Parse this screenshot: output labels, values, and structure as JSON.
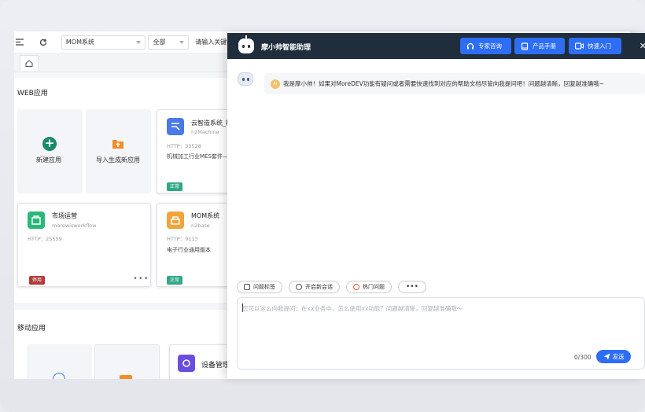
{
  "toolbar": {
    "system_select": "MOM系统",
    "scope_select": "全部",
    "search_placeholder": "请输入关键"
  },
  "sections": {
    "web": "WEB应用",
    "mobile": "移动应用"
  },
  "web_cards": {
    "new_app": "新建应用",
    "import_app": "导入生成新应用",
    "apps": [
      {
        "name": "云智造系统_柜",
        "code": "n2Machine",
        "http": "HTTP：33528",
        "desc": "机械加工行业MES套件—",
        "status": "正常",
        "color": "#4a7ae8"
      },
      {
        "name": "市场运营",
        "code": "morewisworkflow",
        "http": "HTTP：25559",
        "desc": "",
        "status": "停用",
        "color": "#2ab87a"
      },
      {
        "name": "MOM系统",
        "code": "n2base",
        "http": "HTTP：9113",
        "desc": "电子行业通用版本",
        "status": "正常",
        "color": "#f0a43a"
      }
    ],
    "more": "•••"
  },
  "mobile_cards": {
    "device_mgmt": "设备管理"
  },
  "chat": {
    "title": "摩小帅智能助理",
    "buttons": [
      "专家咨询",
      "产品手册",
      "快速入门"
    ],
    "greeting_badge": "AI",
    "greeting": "我是摩小帅！如果对MoreDEV功能有疑问或者需要快速找到对应的帮助文档尽管向我提问吧！问题越清晰，回复越准确哦~",
    "quick_actions": [
      "问题标签",
      "开启新会话",
      "热门问题"
    ],
    "quick_more": "•••",
    "input_placeholder": "您可以这么向我提问：在xx业务中，怎么使用xx功能？问题越清晰，回复越准确哦～",
    "counter": "0/300",
    "send": "发送"
  },
  "colors": {
    "header_bg": "#1f2d3d",
    "accent": "#2e6ef5",
    "status_ok": "#2fa886",
    "status_stop": "#b33a3a"
  }
}
